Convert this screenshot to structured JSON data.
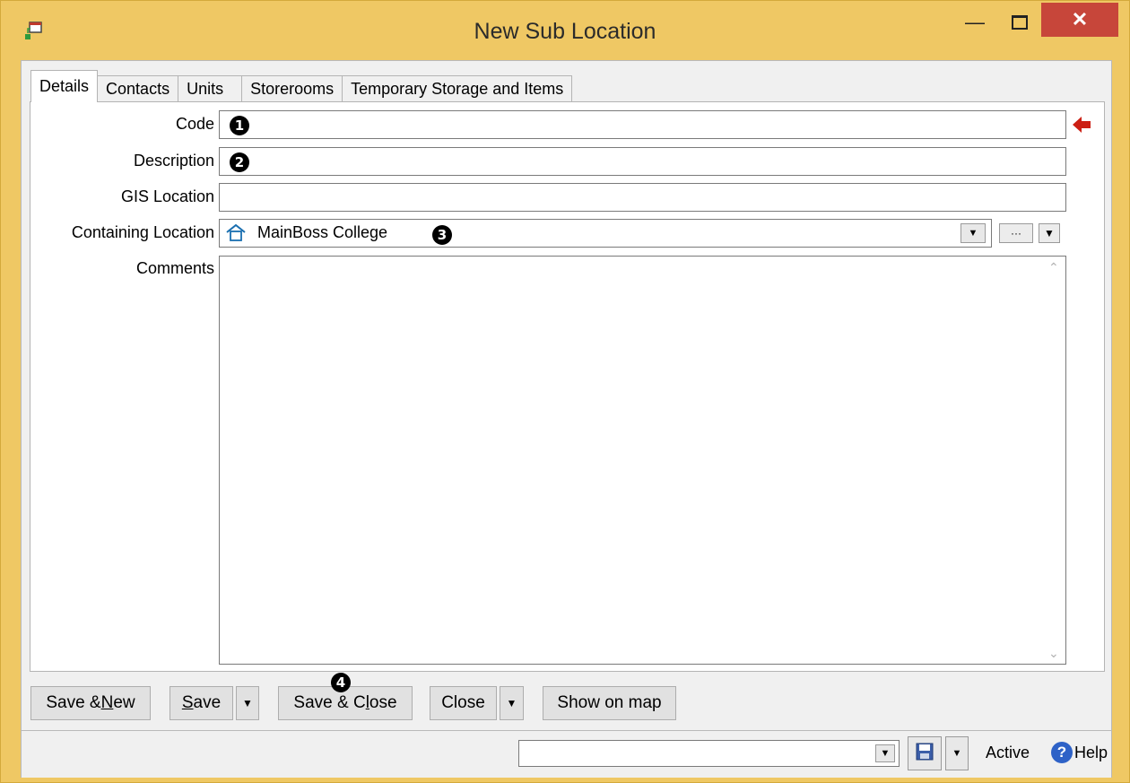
{
  "window": {
    "title": "New Sub Location"
  },
  "tabs": [
    {
      "label": "Details"
    },
    {
      "label": "Contacts"
    },
    {
      "label": "Units"
    },
    {
      "label": "Storerooms"
    },
    {
      "label": "Temporary Storage and Items"
    }
  ],
  "form": {
    "code": {
      "label": "Code",
      "value": ""
    },
    "description": {
      "label": "Description",
      "value": ""
    },
    "gis": {
      "label": "GIS Location",
      "value": ""
    },
    "containing": {
      "label": "Containing Location",
      "value": "MainBoss College",
      "icon": "house-icon"
    },
    "comments": {
      "label": "Comments",
      "value": ""
    }
  },
  "callouts": {
    "c1": "1",
    "c2": "2",
    "c3": "3",
    "c4": "4"
  },
  "buttons": {
    "save_new": {
      "pre": "Save & ",
      "u": "N",
      "post": "ew"
    },
    "save": {
      "pre": "",
      "u": "S",
      "post": "ave"
    },
    "save_close": {
      "pre": "Save & C",
      "u": "l",
      "post": "ose"
    },
    "close": "Close",
    "show_map": "Show on map",
    "browse": "···"
  },
  "statusbar": {
    "dropdown_value": "",
    "status": "Active",
    "help": "Help"
  },
  "colors": {
    "accent_arrow": "#cc1f14",
    "close_button": "#c7463a",
    "titlebar": "#efc864"
  }
}
